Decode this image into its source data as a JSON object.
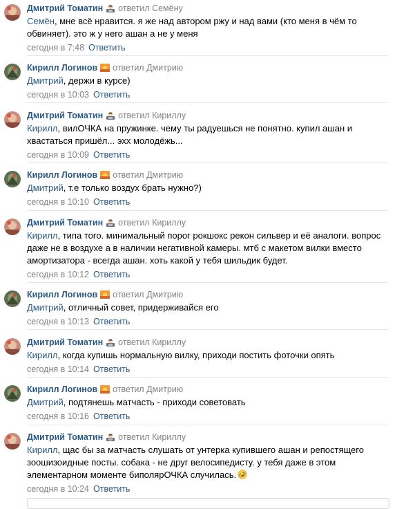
{
  "colors": {
    "author": "#2a5885",
    "muted": "#828282",
    "divider": "#e7e8ec"
  },
  "comments": [
    {
      "author": "Дмитрий Томатин",
      "author_emoji": "technologist-emoji",
      "replied": "ответил Семёну",
      "mention": "Семён",
      "text": ", мне всё нравится. я же над автором ржу и над вами (кто меня в чём то обвиняет). это ж у него ашан а не у меня",
      "date": "сегодня в 7:48",
      "reply_label": "Ответить"
    },
    {
      "author": "Кирилл Логинов",
      "author_emoji": "sunset-emoji",
      "replied": "ответил Дмитрию",
      "mention": "Дмитрий",
      "text": ", держи в курсе)",
      "date": "сегодня в 10:03",
      "reply_label": "Ответить"
    },
    {
      "author": "Дмитрий Томатин",
      "author_emoji": "technologist-emoji",
      "replied": "ответил Кириллу",
      "mention": "Кирилл",
      "text": ", вилОЧКА на пружинке. чему ты радуешься не понятно. купил ашан и хвастаться пришёл... эхх молодёжь...",
      "date": "сегодня в 10:09",
      "reply_label": "Ответить"
    },
    {
      "author": "Кирилл Логинов",
      "author_emoji": "sunset-emoji",
      "replied": "ответил Дмитрию",
      "mention": "Дмитрий",
      "text": ", т.е только воздух брать нужно?)",
      "date": "сегодня в 10:10",
      "reply_label": "Ответить"
    },
    {
      "author": "Дмитрий Томатин",
      "author_emoji": "technologist-emoji",
      "replied": "ответил Кириллу",
      "mention": "Кирилл",
      "text": ", типа того. минимальный порог рокшокс рекон сильвер и её аналоги. вопрос даже не в воздухе а в наличии негативной камеры. мтб с макетом вилки вместо амортизатора - всегда ашан. хоть какой у тебя шильдик будет.",
      "date": "сегодня в 10:12",
      "reply_label": "Ответить"
    },
    {
      "author": "Кирилл Логинов",
      "author_emoji": "sunset-emoji",
      "replied": "ответил Дмитрию",
      "mention": "Дмитрий",
      "text": ", отличный совет, придерживайся его",
      "date": "сегодня в 10:13",
      "reply_label": "Ответить"
    },
    {
      "author": "Дмитрий Томатин",
      "author_emoji": "technologist-emoji",
      "replied": "ответил Кириллу",
      "mention": "Кирилл",
      "text": ", когда купишь нормальную вилку, приходи постить фоточки опять",
      "date": "сегодня в 10:14",
      "reply_label": "Ответить"
    },
    {
      "author": "Кирилл Логинов",
      "author_emoji": "sunset-emoji",
      "replied": "ответил Дмитрию",
      "mention": "Дмитрий",
      "text": ", подтянешь матчасть - приходи советовать",
      "date": "сегодня в 10:16",
      "reply_label": "Ответить"
    },
    {
      "author": "Дмитрий Томатин",
      "author_emoji": "technologist-emoji",
      "replied": "ответил Кириллу",
      "mention": "Кирилл",
      "text": ", щас бы за матчасть слушать от унтерка купившего ашан и репостящего зоошизоидные посты. собака - не друг велосипедисту. у тебя даже в этом элементарном моменте биполярОЧКА случилась.",
      "text_emoji": "rofl-emoji",
      "date": "сегодня в 10:24",
      "reply_label": "Ответить"
    }
  ]
}
